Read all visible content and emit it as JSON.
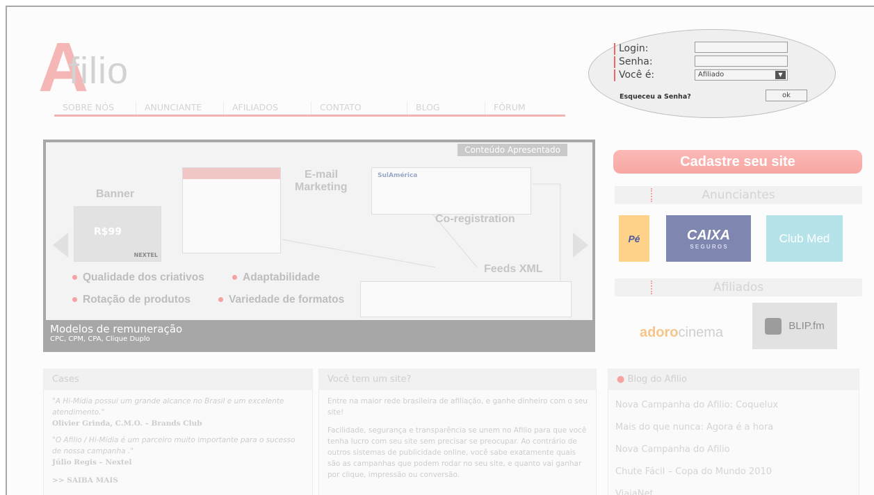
{
  "brand": {
    "logo_letter": "A",
    "logo_word": "filio",
    "accent": "#f4b7b5"
  },
  "nav": [
    {
      "label": "SOBRE NÓS"
    },
    {
      "label": "ANUNCIANTE"
    },
    {
      "label": "AFILIADOS"
    },
    {
      "label": "CONTATO"
    },
    {
      "label": "BLOG"
    },
    {
      "label": "FÓRUM"
    }
  ],
  "login": {
    "login_label": "Login:",
    "senha_label": "Senha:",
    "voce_label": "Você é:",
    "voce_value": "Afiliado",
    "forgot": "Esqueceu a Senha?",
    "ok": "ok"
  },
  "feature": {
    "tag": "Conteúdo Apresentado",
    "banner_label": "Banner",
    "email_label_1": "E-mail",
    "email_label_2": "Marketing",
    "coreg_label": "Co-registration",
    "feeds_label": "Feeds XML",
    "bullets": [
      "Qualidade dos criativos",
      "Adaptabilidade",
      "Rotação de produtos",
      "Variedade de formatos"
    ],
    "caption_title": "Modelos de remuneração",
    "caption_sub": "CPC, CPM, CPA, Clique Duplo",
    "phone_price": "R$99",
    "phone_brand": "NEXTEL",
    "sul_america": "SulAmérica"
  },
  "right": {
    "cadastre": "Cadastre seu site",
    "anunciantes": "Anunciantes",
    "afiliados": "Afiliados",
    "logos": {
      "pe": "Pé",
      "caixa_1": "CAIXA",
      "caixa_2": "S E G U R O S",
      "clubmed": "Club Med",
      "adoro_1": "adoro",
      "adoro_2": "cinema",
      "blip": "BLIP.fm"
    }
  },
  "cases": {
    "title": "Cases",
    "q1": "\"A Hi-Mídia possui um grande alcance no Brasil e um excelente atendimento.\"",
    "a1": "Olivier Grinda, C.M.O. – Brands Club",
    "q2": "\"O Afilio / Hi-Mídia é um parceiro muito importante para o sucesso de nossa campanha .\"",
    "a2": "Júlio Regis – Nextel",
    "more": ">> SAIBA MAIS"
  },
  "site": {
    "title": "Você tem um site?",
    "p1": "Entre na maior rede brasileira de afiliação, e ganhe dinheiro com o seu site!",
    "p2": "Facilidade, segurança e transparência se unem no Afilio para que você tenha lucro com seu site sem precisar se preocupar. Ao contrário de outros sistemas de publicidade online, você sabe exatamente quais são as campanhas que podem rodar no seu site, e quanto vai ganhar por clique, impressão ou conversão."
  },
  "blog": {
    "title": "Blog do Afilio",
    "items": [
      "Nova Campanha do Afilio: Coquelux",
      "Mais do que nunca: Agora é a hora",
      "Nova Campanha do Afilio",
      "Chute Fácil – Copa do Mundo 2010",
      "ViajaNet"
    ]
  }
}
